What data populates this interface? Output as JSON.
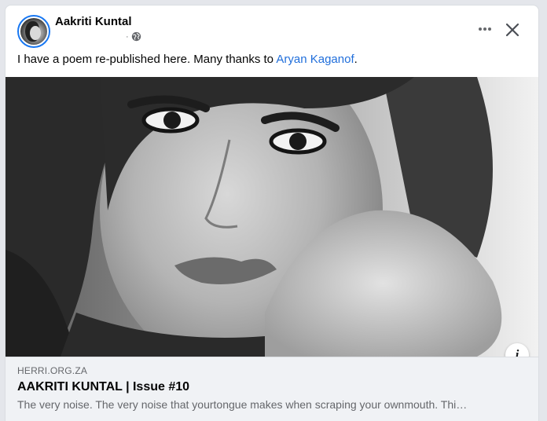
{
  "post": {
    "author_name": "Aakriti Kuntal",
    "timestamp_separator": "·",
    "privacy_icon": "globe-icon",
    "more_icon": "more-horizontal-icon",
    "close_icon": "close-icon",
    "text_before_link": "I have a poem re-published here. Many thanks to ",
    "mention": "Aryan Kaganof",
    "text_after_link": ".",
    "mention_color": "#216fdb",
    "verified_ring_color": "#1877f2"
  },
  "link_preview": {
    "domain": "HERRI.ORG.ZA",
    "title": "AAKRITI KUNTAL | Issue #10",
    "description": "The very noise. The very noise that yourtongue makes when scraping your ownmouth. Thi…",
    "info_icon": "info-icon",
    "info_label": "i"
  }
}
